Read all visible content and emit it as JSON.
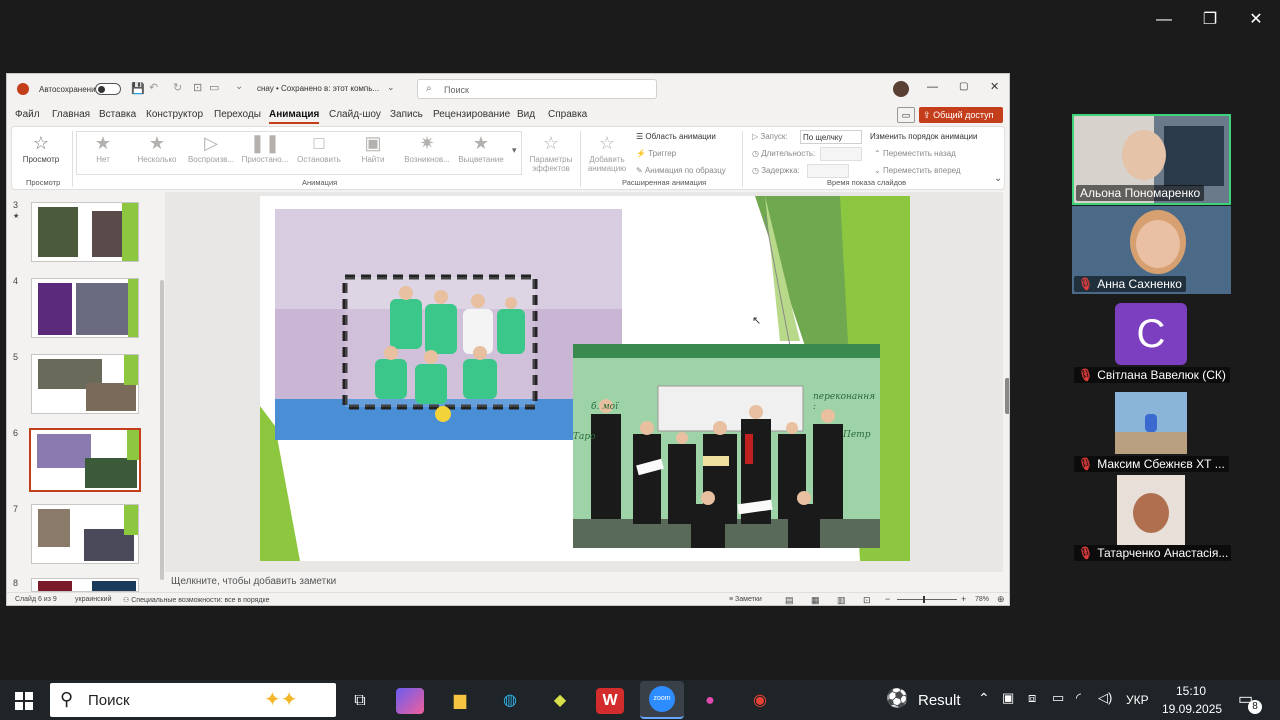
{
  "window": {
    "controls": {
      "minimize": "—",
      "restore": "❐",
      "close": "✕"
    }
  },
  "ppt": {
    "autosave_label": "Автосохранение",
    "doc_title": "снау • Сохранено в: этот компь...",
    "search_placeholder": "Поиск",
    "share_label": "Общий доступ",
    "menu": [
      "Файл",
      "Главная",
      "Вставка",
      "Конструктор",
      "Переходы",
      "Анимация",
      "Слайд-шоу",
      "Запись",
      "Рецензирование",
      "Вид",
      "Справка"
    ],
    "active_menu": "Анимация",
    "ribbon": {
      "preview": "Просмотр",
      "preview_group": "Просмотр",
      "animations": [
        "Нет",
        "Несколько",
        "Воспроизв...",
        "Приостано...",
        "Остановить",
        "Найти",
        "Возникнов...",
        "Выцветание"
      ],
      "animation_group": "Анимация",
      "effect_params": "Параметры эффектов",
      "add_animation": "Добавить анимацию",
      "animation_pane": "Область анимации",
      "trigger": "Триггер",
      "anim_painter": "Анимация по образцу",
      "advanced_group": "Расширенная анимация",
      "start_label": "Запуск:",
      "start_value": "По щелчку",
      "duration_label": "Длительность:",
      "delay_label": "Задержка:",
      "timing_group": "Время показа слайдов",
      "reorder": "Изменить порядок анимации",
      "move_earlier": "Переместить назад",
      "move_later": "Переместить вперед"
    },
    "thumbs": [
      {
        "num": "3",
        "star": "★"
      },
      {
        "num": "4"
      },
      {
        "num": "5"
      },
      {
        "num": "6"
      },
      {
        "num": "7"
      },
      {
        "num": "8"
      }
    ],
    "notes_placeholder": "Щелкните, чтобы добавить заметки",
    "status": {
      "slide": "Слайд 6 из 9",
      "language": "украинский",
      "accessibility": "Специальные возможности: все в порядке",
      "notes": "Заметки",
      "zoom": "78%"
    },
    "slide_text": {
      "board_text_1": "переконання :",
      "board_text_2": "Петр",
      "board_text_3": "б. мої",
      "board_text_4": "Таро"
    }
  },
  "participants": [
    {
      "name": "Альона Пономаренко",
      "muted": false,
      "active": true
    },
    {
      "name": "Анна Сахненко",
      "muted": true
    },
    {
      "name": "Світлана Вавелюк (СК)",
      "muted": true,
      "initial": "C"
    },
    {
      "name": "Максим Сбежнєв ХТ ...",
      "muted": true
    },
    {
      "name": "Татарченко Анастасія...",
      "muted": true
    }
  ],
  "taskbar": {
    "search_label": "Поиск",
    "weather_label": "Result",
    "language": "УКР",
    "time": "15:10",
    "date": "19.09.2025",
    "notif_count": "8",
    "zoom_label": "zoom"
  },
  "colors": {
    "ppt_accent": "#c43e1c",
    "active_speaker": "#3ed37a",
    "slide_green": "#8dc63f",
    "zoom_purple": "#7b3fbf"
  }
}
